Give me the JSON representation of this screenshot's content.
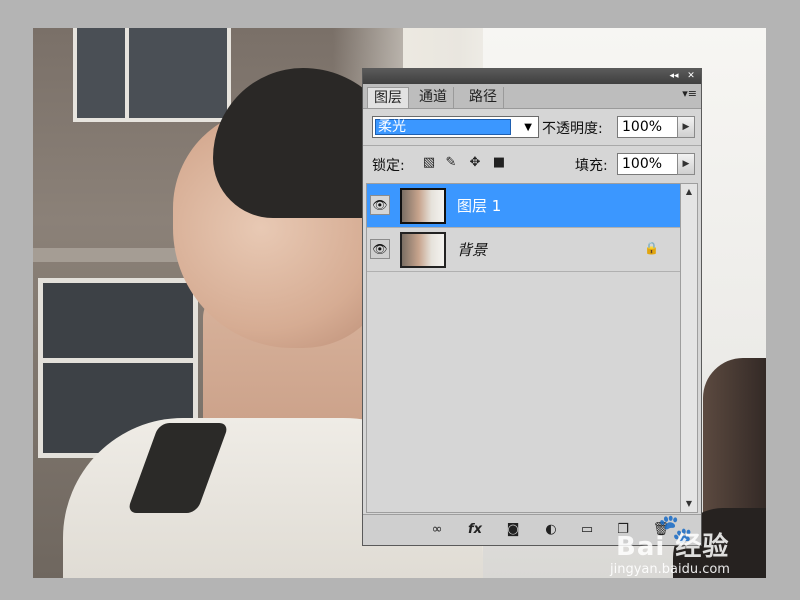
{
  "panel": {
    "tabs": [
      {
        "label": "图层",
        "active": true
      },
      {
        "label": "通道",
        "active": false
      },
      {
        "label": "路径",
        "active": false
      }
    ],
    "collapse_glyph": "◂◂",
    "close_glyph": "✕",
    "menu_glyph": "▾≡",
    "blend_mode": "柔光",
    "opacity_label": "不透明度:",
    "opacity_value": "100%",
    "lock_label": "锁定:",
    "fill_label": "填充:",
    "fill_value": "100%",
    "layers": [
      {
        "name": "图层 1",
        "selected": true,
        "visible": true,
        "locked": false
      },
      {
        "name": "背景",
        "selected": false,
        "visible": true,
        "locked": true
      }
    ],
    "bottom_icons": [
      "link-icon",
      "fx-icon",
      "mask-icon",
      "adjustment-icon",
      "folder-icon",
      "new-layer-icon",
      "trash-icon"
    ]
  },
  "watermark": {
    "logo": "Bai 经验",
    "url": "jingyan.baidu.com"
  },
  "colors": {
    "selection": "#3b97ff",
    "panel_bg": "#d6d6d6",
    "titlebar": "#4a4a4a"
  }
}
